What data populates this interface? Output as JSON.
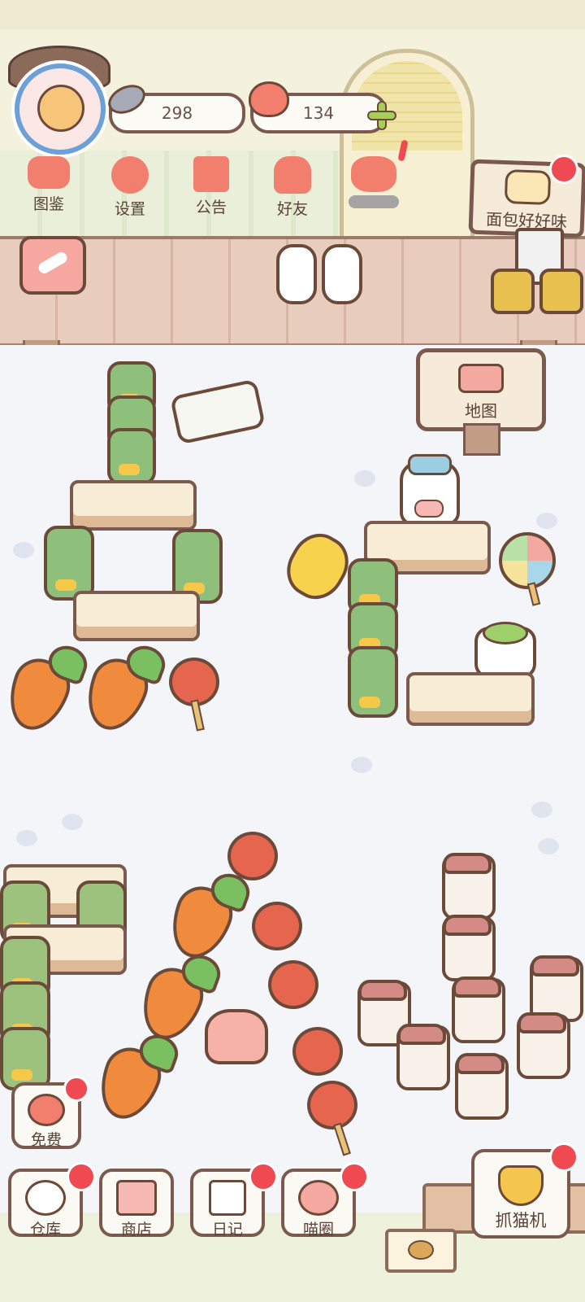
{
  "currency": {
    "fish": {
      "value": "298",
      "icon": "fish-icon"
    },
    "hearts": {
      "value": "134",
      "icon": "heart-icon",
      "add_icon": "plus-icon"
    }
  },
  "top_menu": [
    {
      "label": "图鉴",
      "icon": "cat-book-icon"
    },
    {
      "label": "设置",
      "icon": "gear-icon"
    },
    {
      "label": "公告",
      "icon": "gift-icon"
    },
    {
      "label": "好友",
      "icon": "friends-icon"
    },
    {
      "label": "",
      "icon": "hearts-event-icon"
    }
  ],
  "signs": {
    "bread": "面包好好味",
    "map": "地图"
  },
  "free_button": {
    "label": "免费"
  },
  "bottom_nav": [
    {
      "label": "仓库",
      "icon": "warehouse-icon"
    },
    {
      "label": "商店",
      "icon": "shop-icon"
    },
    {
      "label": "日记",
      "icon": "diary-icon"
    },
    {
      "label": "喵圈",
      "icon": "cat-planet-icon"
    }
  ],
  "claw_machine": {
    "label": "抓猫机",
    "icon": "claw-icon"
  },
  "colors": {
    "outline": "#6b4a3a",
    "accent_red": "#ef4a52",
    "coral": "#f27e6e",
    "green": "#8ec07c",
    "wood": "#e8cdbf"
  }
}
